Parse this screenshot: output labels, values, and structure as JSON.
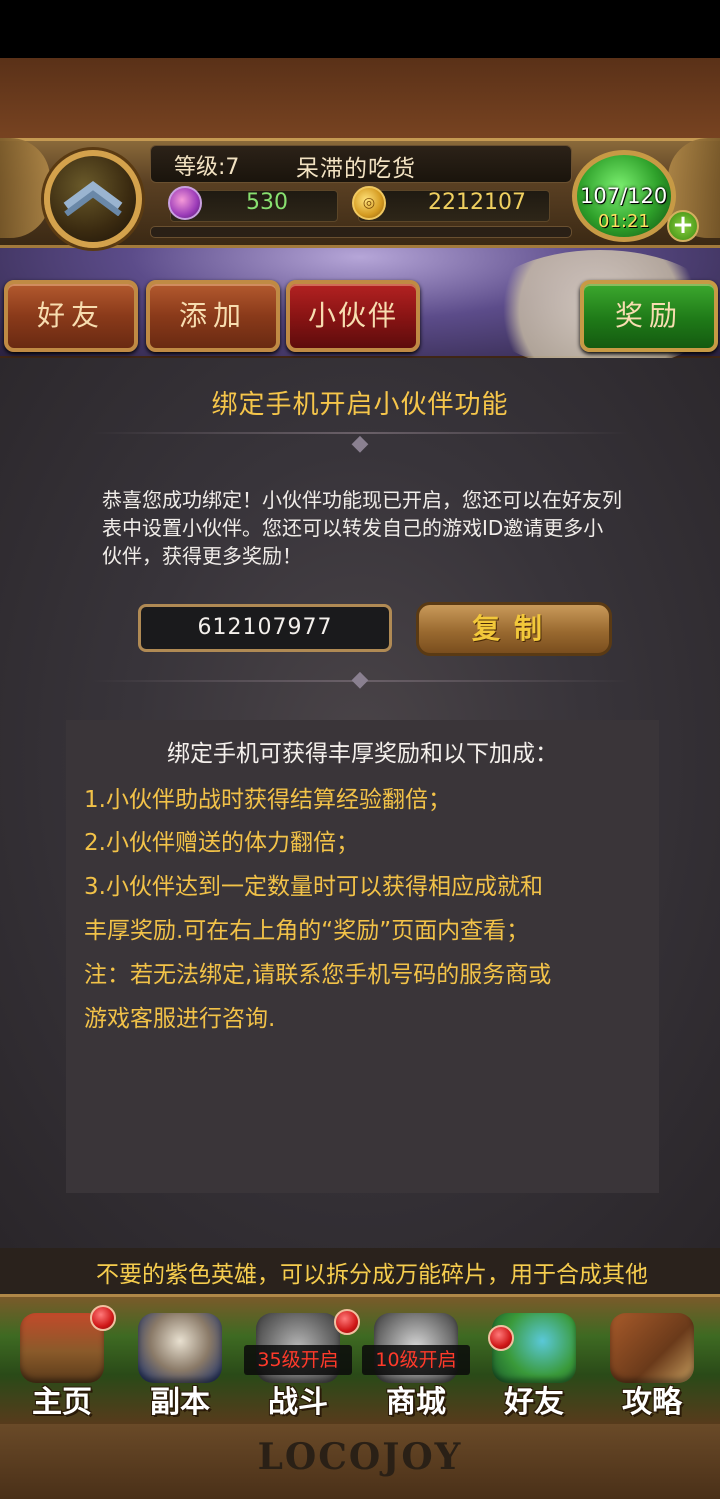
{
  "hud": {
    "level": "等级:7",
    "player_name": "呆滞的吃货",
    "gems": "530",
    "coins": "2212107",
    "energy": "107/120",
    "timer": "01:21",
    "plus": "+"
  },
  "tabs": {
    "friends": "好友",
    "add": "添加",
    "partner": "小伙伴",
    "reward": "奖励"
  },
  "panel": {
    "title": "绑定手机开启小伙伴功能",
    "intro": "恭喜您成功绑定！小伙伴功能现已开启，您还可以在好友列表中设置小伙伴。您还可以转发自己的游戏ID邀请更多小伙伴，获得更多奖励！",
    "game_id": "612107977",
    "copy_button": "复制",
    "info_header": "绑定手机可获得丰厚奖励和以下加成：",
    "info_lines": [
      "1.小伙伴助战时获得结算经验翻倍；",
      "2.小伙伴赠送的体力翻倍；",
      "3.小伙伴达到一定数量时可以获得相应成就和",
      "丰厚奖励.可在右上角的“奖励”页面内查看；",
      "注：若无法绑定,请联系您手机号码的服务商或",
      "游戏客服进行咨询."
    ]
  },
  "ticker": "不要的紫色英雄，可以拆分成万能碎片，用于合成其他",
  "nav": {
    "home": "主页",
    "dungeon": "副本",
    "battle": "战斗",
    "battle_lock": "35级开启",
    "shop": "商城",
    "shop_lock": "10级开启",
    "friends": "好友",
    "guide": "攻略"
  },
  "footer_logo": "LOCOJOY",
  "icons": {
    "rank": "chevron-rank-icon",
    "gem": "gem-icon",
    "coin": "coin-icon"
  },
  "colors": {
    "title_gold": "#f6c64a",
    "info_text": "#f2c248",
    "reward_green": "#2e9a24",
    "partner_red": "#a01a1a"
  }
}
